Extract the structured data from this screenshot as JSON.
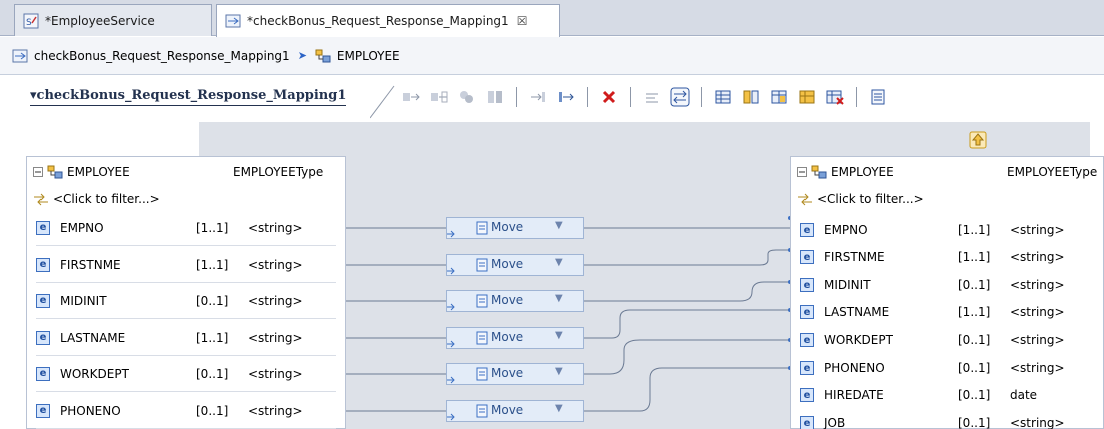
{
  "tabs": [
    {
      "label": "*EmployeeService"
    },
    {
      "label": "*checkBonus_Request_Response_Mapping1",
      "close": "☒"
    }
  ],
  "breadcrumb": {
    "items": [
      "checkBonus_Request_Response_Mapping1",
      "EMPLOYEE"
    ],
    "separator": "➤"
  },
  "editor": {
    "title": "▾checkBonus_Request_Response_Mapping1"
  },
  "source": {
    "name": "EMPLOYEE",
    "type": "EMPLOYEEType",
    "filter": "<Click to filter...>",
    "fields": [
      {
        "name": "EMPNO",
        "card": "[1..1]",
        "type": "<string>"
      },
      {
        "name": "FIRSTNME",
        "card": "[1..1]",
        "type": "<string>"
      },
      {
        "name": "MIDINIT",
        "card": "[0..1]",
        "type": "<string>"
      },
      {
        "name": "LASTNAME",
        "card": "[1..1]",
        "type": "<string>"
      },
      {
        "name": "WORKDEPT",
        "card": "[0..1]",
        "type": "<string>"
      },
      {
        "name": "PHONENO",
        "card": "[0..1]",
        "type": "<string>"
      }
    ]
  },
  "target": {
    "name": "EMPLOYEE",
    "type": "EMPLOYEEType",
    "filter": "<Click to filter...>",
    "fields": [
      {
        "name": "EMPNO",
        "card": "[1..1]",
        "type": "<string>"
      },
      {
        "name": "FIRSTNME",
        "card": "[1..1]",
        "type": "<string>"
      },
      {
        "name": "MIDINIT",
        "card": "[0..1]",
        "type": "<string>"
      },
      {
        "name": "LASTNAME",
        "card": "[1..1]",
        "type": "<string>"
      },
      {
        "name": "WORKDEPT",
        "card": "[0..1]",
        "type": "<string>"
      },
      {
        "name": "PHONENO",
        "card": "[0..1]",
        "type": "<string>"
      },
      {
        "name": "HIREDATE",
        "card": "[0..1]",
        "type": "date"
      },
      {
        "name": "JOB",
        "card": "[0..1]",
        "type": "<string>"
      }
    ]
  },
  "transforms": [
    {
      "label": "Move",
      "arrow": "▼"
    },
    {
      "label": "Move",
      "arrow": "▼"
    },
    {
      "label": "Move",
      "arrow": "▼"
    },
    {
      "label": "Move",
      "arrow": "▼"
    },
    {
      "label": "Move",
      "arrow": "▼"
    },
    {
      "label": "Move",
      "arrow": "▼"
    }
  ],
  "colors": {
    "canvas": "#dde1e8",
    "element_icon": "#3d6fbf",
    "connector": "#6b7a93",
    "delete": "#d01c1c"
  }
}
